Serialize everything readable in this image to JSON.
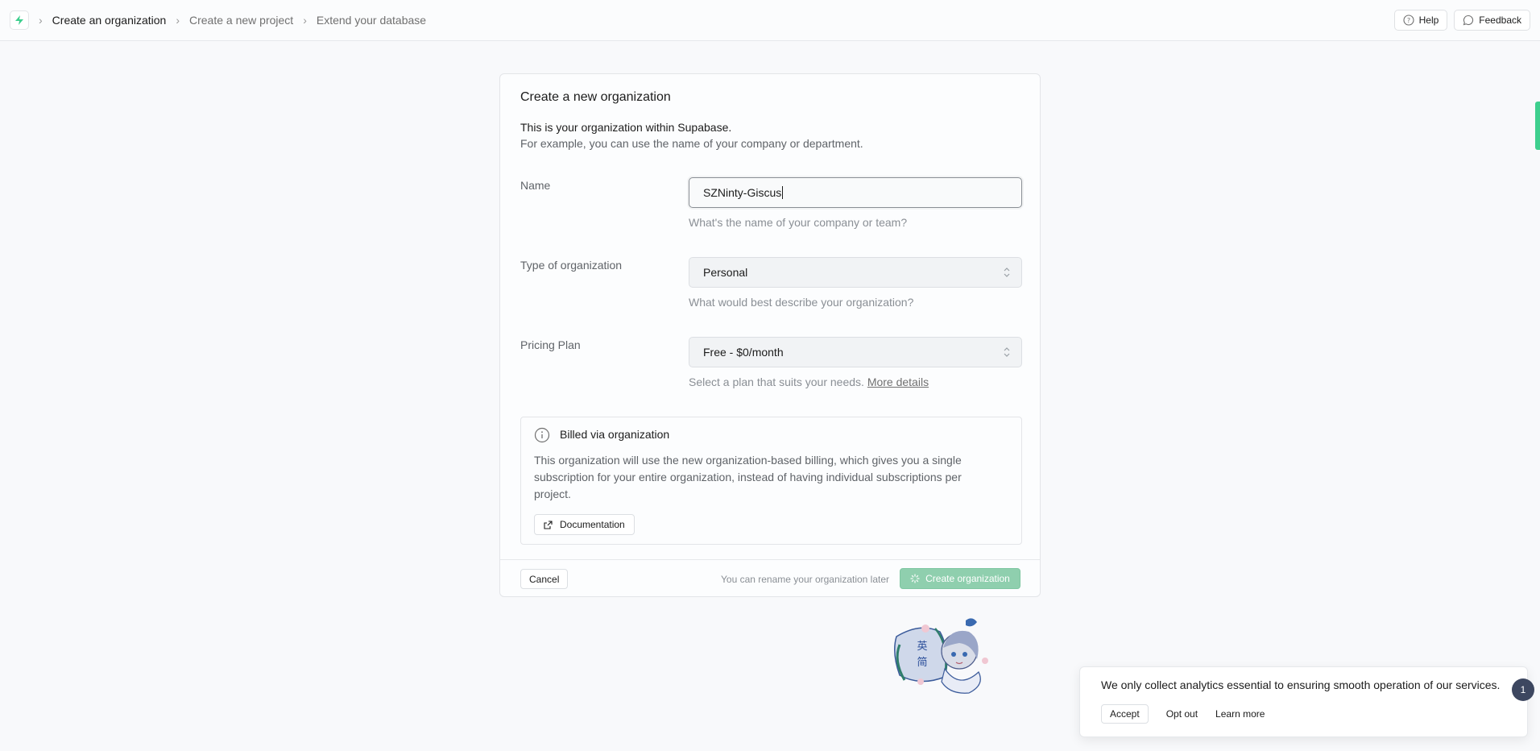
{
  "breadcrumb": {
    "items": [
      "Create an organization",
      "Create a new project",
      "Extend your database"
    ]
  },
  "header": {
    "help_label": "Help",
    "feedback_label": "Feedback"
  },
  "card": {
    "title": "Create a new organization",
    "intro_line1": "This is your organization within Supabase.",
    "intro_line2": "For example, you can use the name of your company or department.",
    "name": {
      "label": "Name",
      "value": "SZNinty-Giscus",
      "help": "What's the name of your company or team?"
    },
    "type": {
      "label": "Type of organization",
      "value": "Personal",
      "help": "What would best describe your organization?"
    },
    "plan": {
      "label": "Pricing Plan",
      "value": "Free - $0/month",
      "help": "Select a plan that suits your needs.",
      "help_link": "More details"
    },
    "billing": {
      "title": "Billed via organization",
      "body": "This organization will use the new organization-based billing, which gives you a single subscription for your entire organization, instead of having individual subscriptions per project.",
      "doc_label": "Documentation"
    },
    "footer": {
      "cancel_label": "Cancel",
      "rename_note": "You can rename your organization later",
      "create_label": "Create organization"
    }
  },
  "mascot": {
    "glyph1": "英",
    "glyph2": "简"
  },
  "cookie": {
    "text": "We only collect analytics essential to ensuring smooth operation of our services.",
    "accept_label": "Accept",
    "optout_label": "Opt out",
    "learn_label": "Learn more",
    "badge_count": "1"
  },
  "colors": {
    "brand": "#3ecf8e",
    "create_button": "#8fcfae",
    "badge": "#3d4760"
  }
}
